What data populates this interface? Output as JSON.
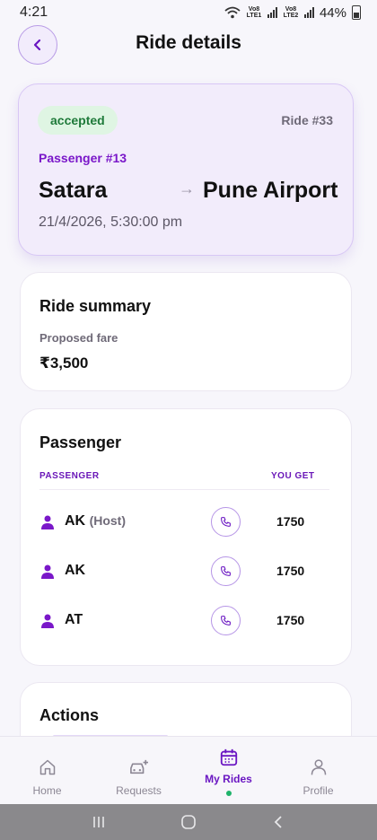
{
  "status_bar": {
    "time": "4:21",
    "sim1": "Vo8 LTE1",
    "sim2": "Vo8 LTE2",
    "battery": "44%"
  },
  "header": {
    "title": "Ride details"
  },
  "ride": {
    "status": "accepted",
    "ride_number": "Ride #33",
    "passenger_number": "Passenger #13",
    "from": "Satara",
    "to": "Pune Airport",
    "datetime": "21/4/2026, 5:30:00 pm"
  },
  "summary": {
    "title": "Ride summary",
    "fare_label": "Proposed fare",
    "fare_value": "₹3,500"
  },
  "passengers": {
    "title": "Passenger",
    "col_passenger": "PASSENGER",
    "col_you_get": "YOU GET",
    "rows": [
      {
        "name": "AK",
        "tag": "(Host)",
        "amount": "1750"
      },
      {
        "name": "AK",
        "tag": "",
        "amount": "1750"
      },
      {
        "name": "AT",
        "tag": "",
        "amount": "1750"
      }
    ]
  },
  "actions": {
    "title": "Actions"
  },
  "bottom_nav": {
    "items": [
      {
        "label": "Home",
        "icon": "home-icon",
        "active": false
      },
      {
        "label": "Requests",
        "icon": "car-plus-icon",
        "active": false
      },
      {
        "label": "My Rides",
        "icon": "calendar-icon",
        "active": true
      },
      {
        "label": "Profile",
        "icon": "person-icon",
        "active": false
      }
    ]
  },
  "colors": {
    "accent": "#6a16c2",
    "badge_bg": "#dff5e3",
    "badge_text": "#1f7a3a",
    "active_dot": "#1fb36a"
  }
}
